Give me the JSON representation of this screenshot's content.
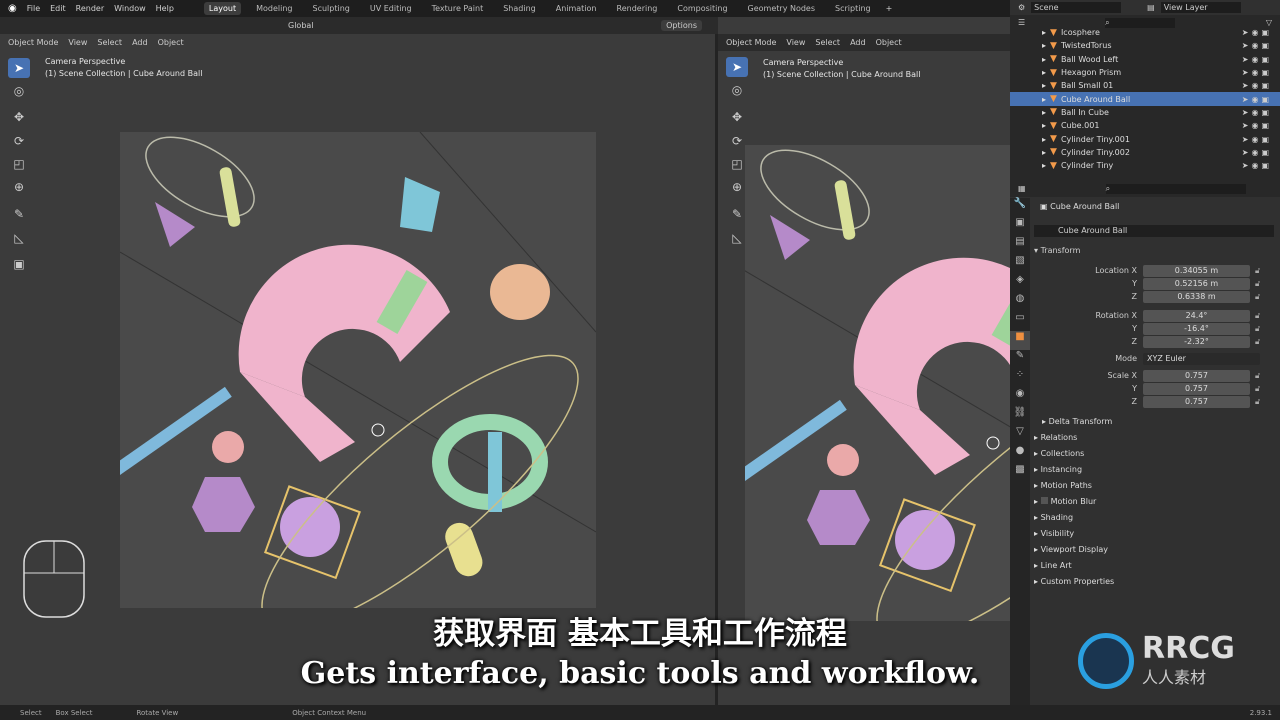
{
  "topbar": {
    "menus": [
      "File",
      "Edit",
      "Render",
      "Window",
      "Help"
    ],
    "workspaces": [
      "Layout",
      "Modeling",
      "Sculpting",
      "UV Editing",
      "Texture Paint",
      "Shading",
      "Animation",
      "Rendering",
      "Compositing",
      "Geometry Nodes",
      "Scripting"
    ],
    "active_workspace": "Layout"
  },
  "tool_header": {
    "orientation": "Global",
    "options": "Options"
  },
  "viewport": {
    "mode": "Object Mode",
    "menus": [
      "View",
      "Select",
      "Add",
      "Object"
    ],
    "view_name": "Camera Perspective",
    "collection": "(1) Scene Collection | Cube Around Ball"
  },
  "outliner": {
    "scene": "Scene",
    "view_layer": "View Layer",
    "items": [
      {
        "name": "Icosphere"
      },
      {
        "name": "TwistedTorus"
      },
      {
        "name": "Ball Wood Left"
      },
      {
        "name": "Hexagon Prism"
      },
      {
        "name": "Ball Small 01"
      },
      {
        "name": "Cube Around Ball",
        "selected": true
      },
      {
        "name": "Ball In Cube"
      },
      {
        "name": "Cube.001"
      },
      {
        "name": "Cylinder Tiny.001"
      },
      {
        "name": "Cylinder Tiny.002"
      },
      {
        "name": "Cylinder Tiny"
      }
    ]
  },
  "properties": {
    "object_name": "Cube Around Ball",
    "object_field": "Cube Around Ball",
    "transform_label": "Transform",
    "rows": [
      {
        "label": "Location X",
        "value": "0.34055 m"
      },
      {
        "label": "Y",
        "value": "0.52156 m"
      },
      {
        "label": "Z",
        "value": "0.6338 m"
      },
      {
        "label": "Rotation X",
        "value": "24.4°"
      },
      {
        "label": "Y",
        "value": "-16.4°"
      },
      {
        "label": "Z",
        "value": "-2.32°"
      },
      {
        "label": "Mode",
        "value": "XYZ Euler"
      },
      {
        "label": "Scale X",
        "value": "0.757"
      },
      {
        "label": "Y",
        "value": "0.757"
      },
      {
        "label": "Z",
        "value": "0.757"
      }
    ],
    "panels": [
      "Delta Transform",
      "Relations",
      "Collections",
      "Instancing",
      "Motion Paths",
      "Motion Blur",
      "Shading",
      "Visibility",
      "Viewport Display",
      "Line Art",
      "Custom Properties"
    ]
  },
  "status": {
    "items": [
      "Select",
      "Box Select",
      "Rotate View",
      "Object Context Menu"
    ],
    "version": "2.93.1"
  },
  "subtitles": {
    "zh": "获取界面 基本工具和工作流程",
    "en": "Gets interface, basic tools and workflow."
  },
  "watermark": {
    "logo": "RRCG",
    "sub": "人人素材"
  },
  "colors": {
    "accent": "#4772b3",
    "object_orange": "#f29a4a"
  }
}
